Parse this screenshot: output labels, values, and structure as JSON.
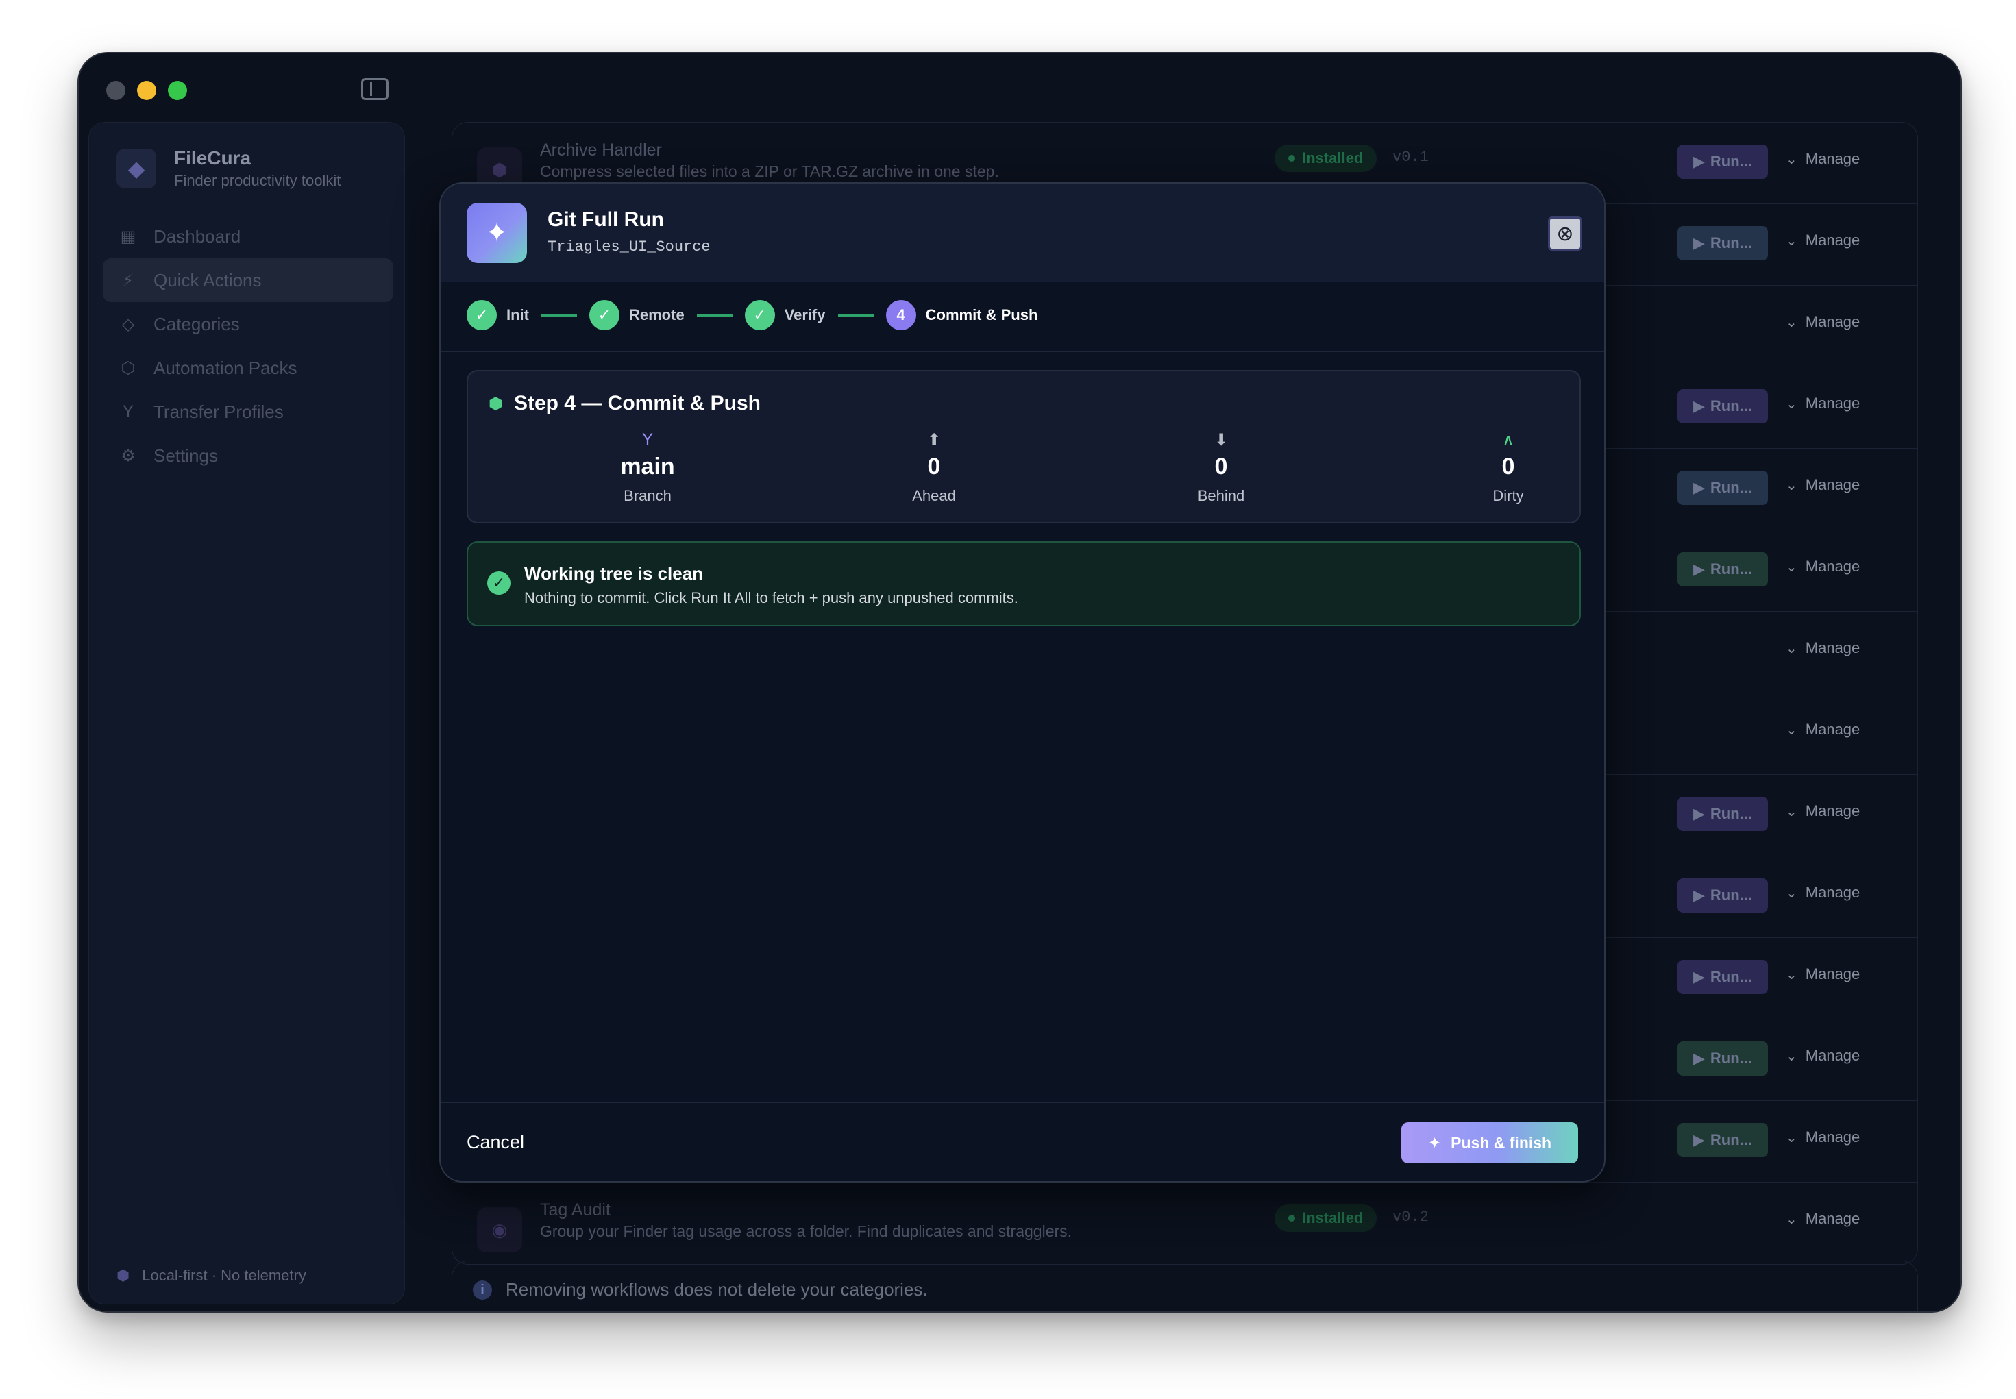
{
  "app": {
    "name": "FileCura",
    "tagline": "Finder productivity toolkit",
    "footer": "Local-first · No telemetry"
  },
  "sidebar": {
    "items": [
      {
        "label": "Dashboard",
        "icon": "grid-icon"
      },
      {
        "label": "Quick Actions",
        "icon": "bolt-icon",
        "active": true
      },
      {
        "label": "Categories",
        "icon": "tag-icon"
      },
      {
        "label": "Automation Packs",
        "icon": "box-icon"
      },
      {
        "label": "Transfer Profiles",
        "icon": "branch-icon"
      },
      {
        "label": "Settings",
        "icon": "gear-icon"
      }
    ]
  },
  "list": {
    "rows": [
      {
        "name": "Archive Handler",
        "desc": "Compress selected files into a ZIP or TAR.GZ archive in one step.",
        "status": "Installed",
        "version": "v0.1",
        "run": "Run...",
        "run_style": "violet",
        "manage": "Manage"
      },
      {
        "run": "Run...",
        "run_style": "blue",
        "manage": "Manage"
      },
      {
        "manage": "Manage"
      },
      {
        "run": "Run...",
        "run_style": "violet",
        "manage": "Manage"
      },
      {
        "run": "Run...",
        "run_style": "blue",
        "manage": "Manage"
      },
      {
        "run": "Run...",
        "run_style": "green",
        "manage": "Manage"
      },
      {
        "manage": "Manage"
      },
      {
        "manage": "Manage"
      },
      {
        "run": "Run...",
        "run_style": "violet",
        "manage": "Manage"
      },
      {
        "run": "Run...",
        "run_style": "violet",
        "manage": "Manage"
      },
      {
        "run": "Run...",
        "run_style": "violet",
        "manage": "Manage"
      },
      {
        "run": "Run...",
        "run_style": "green",
        "manage": "Manage"
      },
      {
        "run": "Run...",
        "run_style": "green",
        "manage": "Manage"
      },
      {
        "name": "Tag Audit",
        "desc": "Group your Finder tag usage across a folder. Find duplicates and stragglers.",
        "status": "Installed",
        "version": "v0.2",
        "manage": "Manage"
      }
    ],
    "note": "Removing workflows does not delete your categories."
  },
  "modal": {
    "title": "Git Full Run",
    "subtitle": "Triagles_UI_Source",
    "steps": [
      {
        "label": "Init",
        "state": "done"
      },
      {
        "label": "Remote",
        "state": "done"
      },
      {
        "label": "Verify",
        "state": "done"
      },
      {
        "label": "Commit & Push",
        "state": "current",
        "number": "4"
      }
    ],
    "card": {
      "title": "Step 4 — Commit & Push",
      "stats": [
        {
          "value": "main",
          "label": "Branch",
          "icon": "branch-icon"
        },
        {
          "value": "0",
          "label": "Ahead",
          "icon": "arrow-up-circle-icon"
        },
        {
          "value": "0",
          "label": "Behind",
          "icon": "arrow-down-circle-icon"
        },
        {
          "value": "0",
          "label": "Dirty",
          "icon": "caret-up-icon"
        }
      ]
    },
    "alert": {
      "title": "Working tree is clean",
      "text": "Nothing to commit. Click Run It All to fetch + push any unpushed commits."
    },
    "cancel_label": "Cancel",
    "push_label": "Push & finish"
  }
}
